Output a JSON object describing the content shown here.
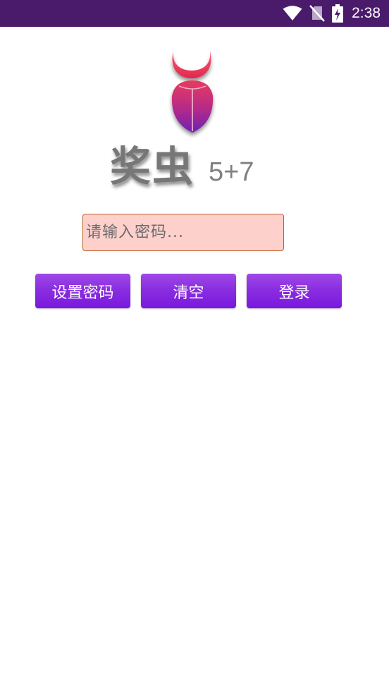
{
  "status_bar": {
    "time": "2:38",
    "icons": [
      "wifi-icon",
      "no-sim-icon",
      "battery-charging-icon"
    ],
    "background": "#4a1a6b"
  },
  "app": {
    "title": "奖虫",
    "version": "5+7",
    "logo_icon": "beetle-logo-icon"
  },
  "password": {
    "placeholder": "请输入密码...",
    "value": ""
  },
  "buttons": {
    "set_password": "设置密码",
    "clear": "清空",
    "login": "登录"
  },
  "colors": {
    "button_top": "#a049e6",
    "button_bottom": "#7a18dd",
    "input_background": "#fdd0cc",
    "input_border": "#c0612a"
  }
}
